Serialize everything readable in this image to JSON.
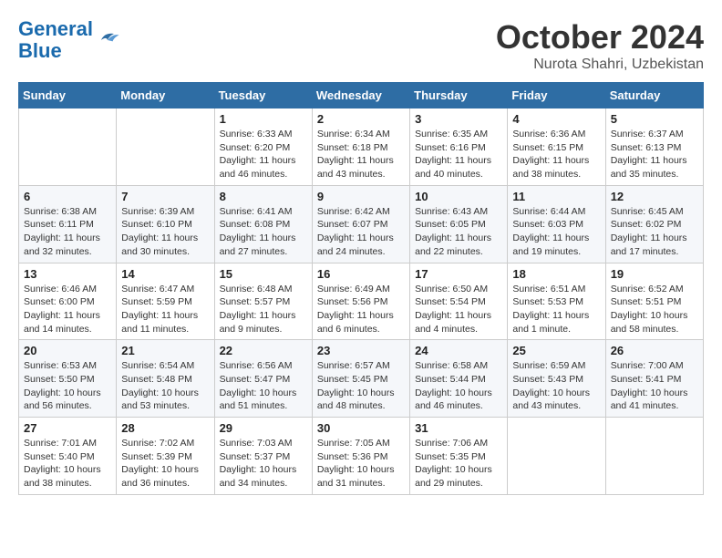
{
  "logo": {
    "line1": "General",
    "line2": "Blue"
  },
  "title": "October 2024",
  "subtitle": "Nurota Shahri, Uzbekistan",
  "days_of_week": [
    "Sunday",
    "Monday",
    "Tuesday",
    "Wednesday",
    "Thursday",
    "Friday",
    "Saturday"
  ],
  "weeks": [
    [
      {
        "day": "",
        "sunrise": "",
        "sunset": "",
        "daylight": ""
      },
      {
        "day": "",
        "sunrise": "",
        "sunset": "",
        "daylight": ""
      },
      {
        "day": "1",
        "sunrise": "Sunrise: 6:33 AM",
        "sunset": "Sunset: 6:20 PM",
        "daylight": "Daylight: 11 hours and 46 minutes."
      },
      {
        "day": "2",
        "sunrise": "Sunrise: 6:34 AM",
        "sunset": "Sunset: 6:18 PM",
        "daylight": "Daylight: 11 hours and 43 minutes."
      },
      {
        "day": "3",
        "sunrise": "Sunrise: 6:35 AM",
        "sunset": "Sunset: 6:16 PM",
        "daylight": "Daylight: 11 hours and 40 minutes."
      },
      {
        "day": "4",
        "sunrise": "Sunrise: 6:36 AM",
        "sunset": "Sunset: 6:15 PM",
        "daylight": "Daylight: 11 hours and 38 minutes."
      },
      {
        "day": "5",
        "sunrise": "Sunrise: 6:37 AM",
        "sunset": "Sunset: 6:13 PM",
        "daylight": "Daylight: 11 hours and 35 minutes."
      }
    ],
    [
      {
        "day": "6",
        "sunrise": "Sunrise: 6:38 AM",
        "sunset": "Sunset: 6:11 PM",
        "daylight": "Daylight: 11 hours and 32 minutes."
      },
      {
        "day": "7",
        "sunrise": "Sunrise: 6:39 AM",
        "sunset": "Sunset: 6:10 PM",
        "daylight": "Daylight: 11 hours and 30 minutes."
      },
      {
        "day": "8",
        "sunrise": "Sunrise: 6:41 AM",
        "sunset": "Sunset: 6:08 PM",
        "daylight": "Daylight: 11 hours and 27 minutes."
      },
      {
        "day": "9",
        "sunrise": "Sunrise: 6:42 AM",
        "sunset": "Sunset: 6:07 PM",
        "daylight": "Daylight: 11 hours and 24 minutes."
      },
      {
        "day": "10",
        "sunrise": "Sunrise: 6:43 AM",
        "sunset": "Sunset: 6:05 PM",
        "daylight": "Daylight: 11 hours and 22 minutes."
      },
      {
        "day": "11",
        "sunrise": "Sunrise: 6:44 AM",
        "sunset": "Sunset: 6:03 PM",
        "daylight": "Daylight: 11 hours and 19 minutes."
      },
      {
        "day": "12",
        "sunrise": "Sunrise: 6:45 AM",
        "sunset": "Sunset: 6:02 PM",
        "daylight": "Daylight: 11 hours and 17 minutes."
      }
    ],
    [
      {
        "day": "13",
        "sunrise": "Sunrise: 6:46 AM",
        "sunset": "Sunset: 6:00 PM",
        "daylight": "Daylight: 11 hours and 14 minutes."
      },
      {
        "day": "14",
        "sunrise": "Sunrise: 6:47 AM",
        "sunset": "Sunset: 5:59 PM",
        "daylight": "Daylight: 11 hours and 11 minutes."
      },
      {
        "day": "15",
        "sunrise": "Sunrise: 6:48 AM",
        "sunset": "Sunset: 5:57 PM",
        "daylight": "Daylight: 11 hours and 9 minutes."
      },
      {
        "day": "16",
        "sunrise": "Sunrise: 6:49 AM",
        "sunset": "Sunset: 5:56 PM",
        "daylight": "Daylight: 11 hours and 6 minutes."
      },
      {
        "day": "17",
        "sunrise": "Sunrise: 6:50 AM",
        "sunset": "Sunset: 5:54 PM",
        "daylight": "Daylight: 11 hours and 4 minutes."
      },
      {
        "day": "18",
        "sunrise": "Sunrise: 6:51 AM",
        "sunset": "Sunset: 5:53 PM",
        "daylight": "Daylight: 11 hours and 1 minute."
      },
      {
        "day": "19",
        "sunrise": "Sunrise: 6:52 AM",
        "sunset": "Sunset: 5:51 PM",
        "daylight": "Daylight: 10 hours and 58 minutes."
      }
    ],
    [
      {
        "day": "20",
        "sunrise": "Sunrise: 6:53 AM",
        "sunset": "Sunset: 5:50 PM",
        "daylight": "Daylight: 10 hours and 56 minutes."
      },
      {
        "day": "21",
        "sunrise": "Sunrise: 6:54 AM",
        "sunset": "Sunset: 5:48 PM",
        "daylight": "Daylight: 10 hours and 53 minutes."
      },
      {
        "day": "22",
        "sunrise": "Sunrise: 6:56 AM",
        "sunset": "Sunset: 5:47 PM",
        "daylight": "Daylight: 10 hours and 51 minutes."
      },
      {
        "day": "23",
        "sunrise": "Sunrise: 6:57 AM",
        "sunset": "Sunset: 5:45 PM",
        "daylight": "Daylight: 10 hours and 48 minutes."
      },
      {
        "day": "24",
        "sunrise": "Sunrise: 6:58 AM",
        "sunset": "Sunset: 5:44 PM",
        "daylight": "Daylight: 10 hours and 46 minutes."
      },
      {
        "day": "25",
        "sunrise": "Sunrise: 6:59 AM",
        "sunset": "Sunset: 5:43 PM",
        "daylight": "Daylight: 10 hours and 43 minutes."
      },
      {
        "day": "26",
        "sunrise": "Sunrise: 7:00 AM",
        "sunset": "Sunset: 5:41 PM",
        "daylight": "Daylight: 10 hours and 41 minutes."
      }
    ],
    [
      {
        "day": "27",
        "sunrise": "Sunrise: 7:01 AM",
        "sunset": "Sunset: 5:40 PM",
        "daylight": "Daylight: 10 hours and 38 minutes."
      },
      {
        "day": "28",
        "sunrise": "Sunrise: 7:02 AM",
        "sunset": "Sunset: 5:39 PM",
        "daylight": "Daylight: 10 hours and 36 minutes."
      },
      {
        "day": "29",
        "sunrise": "Sunrise: 7:03 AM",
        "sunset": "Sunset: 5:37 PM",
        "daylight": "Daylight: 10 hours and 34 minutes."
      },
      {
        "day": "30",
        "sunrise": "Sunrise: 7:05 AM",
        "sunset": "Sunset: 5:36 PM",
        "daylight": "Daylight: 10 hours and 31 minutes."
      },
      {
        "day": "31",
        "sunrise": "Sunrise: 7:06 AM",
        "sunset": "Sunset: 5:35 PM",
        "daylight": "Daylight: 10 hours and 29 minutes."
      },
      {
        "day": "",
        "sunrise": "",
        "sunset": "",
        "daylight": ""
      },
      {
        "day": "",
        "sunrise": "",
        "sunset": "",
        "daylight": ""
      }
    ]
  ]
}
